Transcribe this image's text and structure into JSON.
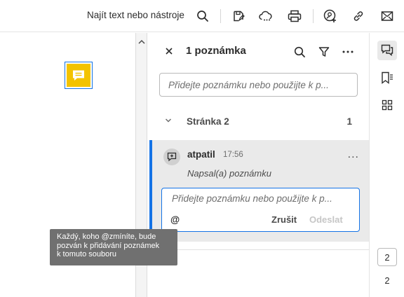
{
  "toolbar": {
    "search_label": "Najít text nebo nástroje",
    "icons": [
      "search-icon",
      "save-icon",
      "cloud-icon",
      "print-icon",
      "share-user-icon",
      "link-icon",
      "mail-icon"
    ]
  },
  "panel": {
    "title": "1 poznámka",
    "icons": [
      "close-icon",
      "search-icon",
      "filter-icon",
      "more-icon"
    ],
    "input_placeholder": "Přidejte poznámku nebo použijte k p...",
    "page_group": {
      "label": "Stránka 2",
      "count": "1"
    },
    "comment": {
      "author": "atpatil",
      "time": "17:56",
      "more": "...",
      "text": "Napsal(a) poznámku"
    },
    "reply": {
      "placeholder": "Přidejte poznámku nebo použijte k p...",
      "mention": "@",
      "cancel": "Zrušit",
      "send": "Odeslat"
    }
  },
  "rail": {
    "icons": [
      "comment-icon",
      "bookmark-list-icon",
      "grid-icon"
    ],
    "current_page": "2",
    "total_pages": "2"
  },
  "tooltip": {
    "lines": [
      "Každý, koho @zmíníte, bude",
      "pozván k přidávání poznámek",
      "k tomuto souboru"
    ]
  },
  "colors": {
    "accent": "#1473e6",
    "note": "#f3c300",
    "tooltip_bg": "#707070",
    "card_bg": "#eaeaea"
  }
}
